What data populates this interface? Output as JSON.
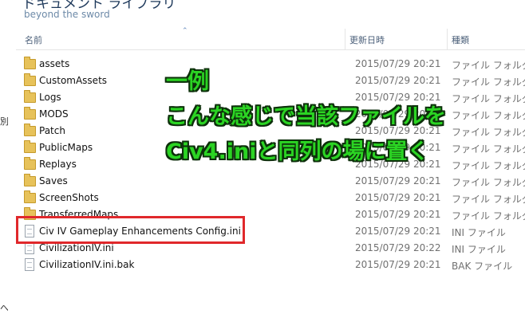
{
  "window": {
    "breadcrumb": "ドキュメント ライブラリ",
    "subtitle": "beyond the sword"
  },
  "left_pane": {
    "fragment1": "別",
    "fragment2": "へ"
  },
  "columns": {
    "name": "名前",
    "date": "更新日時",
    "type": "種類"
  },
  "files": [
    {
      "name": "assets",
      "date": "2015/07/29 20:21",
      "type": "ファイル フォルダー",
      "icon": "folder-icon"
    },
    {
      "name": "CustomAssets",
      "date": "2015/07/29 20:21",
      "type": "ファイル フォルダー",
      "icon": "folder-icon"
    },
    {
      "name": "Logs",
      "date": "2015/07/29 20:21",
      "type": "ファイル フォルダー",
      "icon": "folder-icon"
    },
    {
      "name": "MODS",
      "date": "2015/07/29 20:21",
      "type": "ファイル フォルダー",
      "icon": "folder-icon"
    },
    {
      "name": "Patch",
      "date": "2015/07/29 20:21",
      "type": "ファイル フォルダー",
      "icon": "folder-icon"
    },
    {
      "name": "PublicMaps",
      "date": "2015/07/29 20:21",
      "type": "ファイル フォルダー",
      "icon": "folder-icon"
    },
    {
      "name": "Replays",
      "date": "2015/07/29 20:21",
      "type": "ファイル フォルダー",
      "icon": "folder-icon"
    },
    {
      "name": "Saves",
      "date": "2015/07/29 20:21",
      "type": "ファイル フォルダー",
      "icon": "folder-icon"
    },
    {
      "name": "ScreenShots",
      "date": "2015/07/29 20:21",
      "type": "ファイル フォルダー",
      "icon": "folder-icon"
    },
    {
      "name": "TransferredMaps",
      "date": "2015/07/29 20:21",
      "type": "ファイル フォルダー",
      "icon": "folder-icon"
    },
    {
      "name": "Civ IV Gameplay Enhancements Config.ini",
      "date": "2015/07/29 20:21",
      "type": "INI ファイル",
      "icon": "ini-file-icon"
    },
    {
      "name": "CivilizationIV.ini",
      "date": "2015/07/29 20:22",
      "type": "INI ファイル",
      "icon": "ini-file-icon"
    },
    {
      "name": "CivilizationIV.ini.bak",
      "date": "2015/07/29 20:21",
      "type": "BAK ファイル",
      "icon": "bak-file-icon"
    }
  ],
  "annotation": {
    "line1": "一例",
    "line2": "こんな感じで当該ファイルを",
    "line3": "Civ4.iniと同列の場に置く",
    "text_color": "#2bd423",
    "box_color": "#e0282b"
  }
}
